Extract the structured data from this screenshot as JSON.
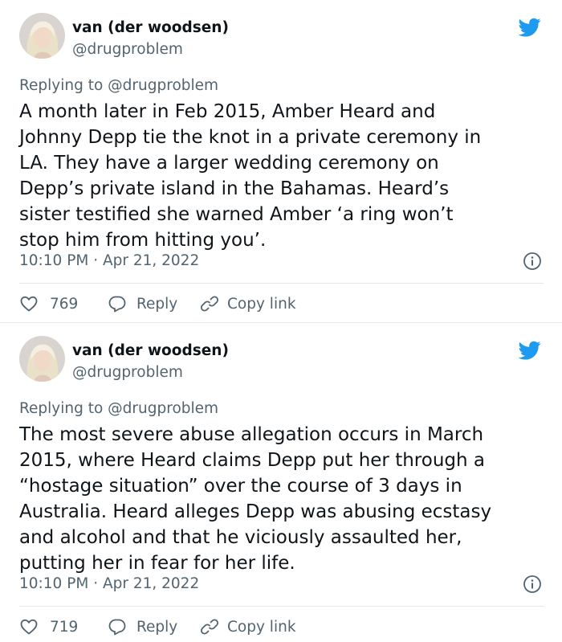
{
  "tweets": [
    {
      "author": {
        "name": "van (der woodsen)",
        "handle": "@drugproblem"
      },
      "replying_to": "Replying to @drugproblem",
      "body": "A month later in Feb 2015, Amber Heard and\nJohnny Depp tie the knot in a private ceremony in\nLA. They have a larger wedding ceremony on\nDepp’s private island in the Bahamas. Heard’s\nsister testified she warned Amber ‘a ring won’t\nstop him from hitting you’.",
      "timestamp": "10:10 PM · Apr 21, 2022",
      "likes": "769",
      "reply_label": "Reply",
      "copy_link_label": "Copy link"
    },
    {
      "author": {
        "name": "van (der woodsen)",
        "handle": "@drugproblem"
      },
      "replying_to": "Replying to @drugproblem",
      "body": "The most severe abuse allegation occurs in March\n2015, where Heard claims Depp put her through a\n“hostage situation” over the course of 3 days in\nAustralia. Heard alleges Depp was abusing ecstasy\nand alcohol and that he viciously assaulted her,\nputting her in fear for her life.",
      "timestamp": "10:10 PM · Apr 21, 2022",
      "likes": "719",
      "reply_label": "Reply",
      "copy_link_label": "Copy link"
    }
  ],
  "icons": {
    "brand": "twitter-bird-icon",
    "info": "info-icon",
    "like": "heart-icon",
    "reply": "reply-bubble-icon",
    "copy": "link-icon"
  },
  "colors": {
    "twitter_blue": "#1d9bf0",
    "muted": "#536471",
    "text": "#0f1419",
    "divider": "#e1e8ed"
  }
}
